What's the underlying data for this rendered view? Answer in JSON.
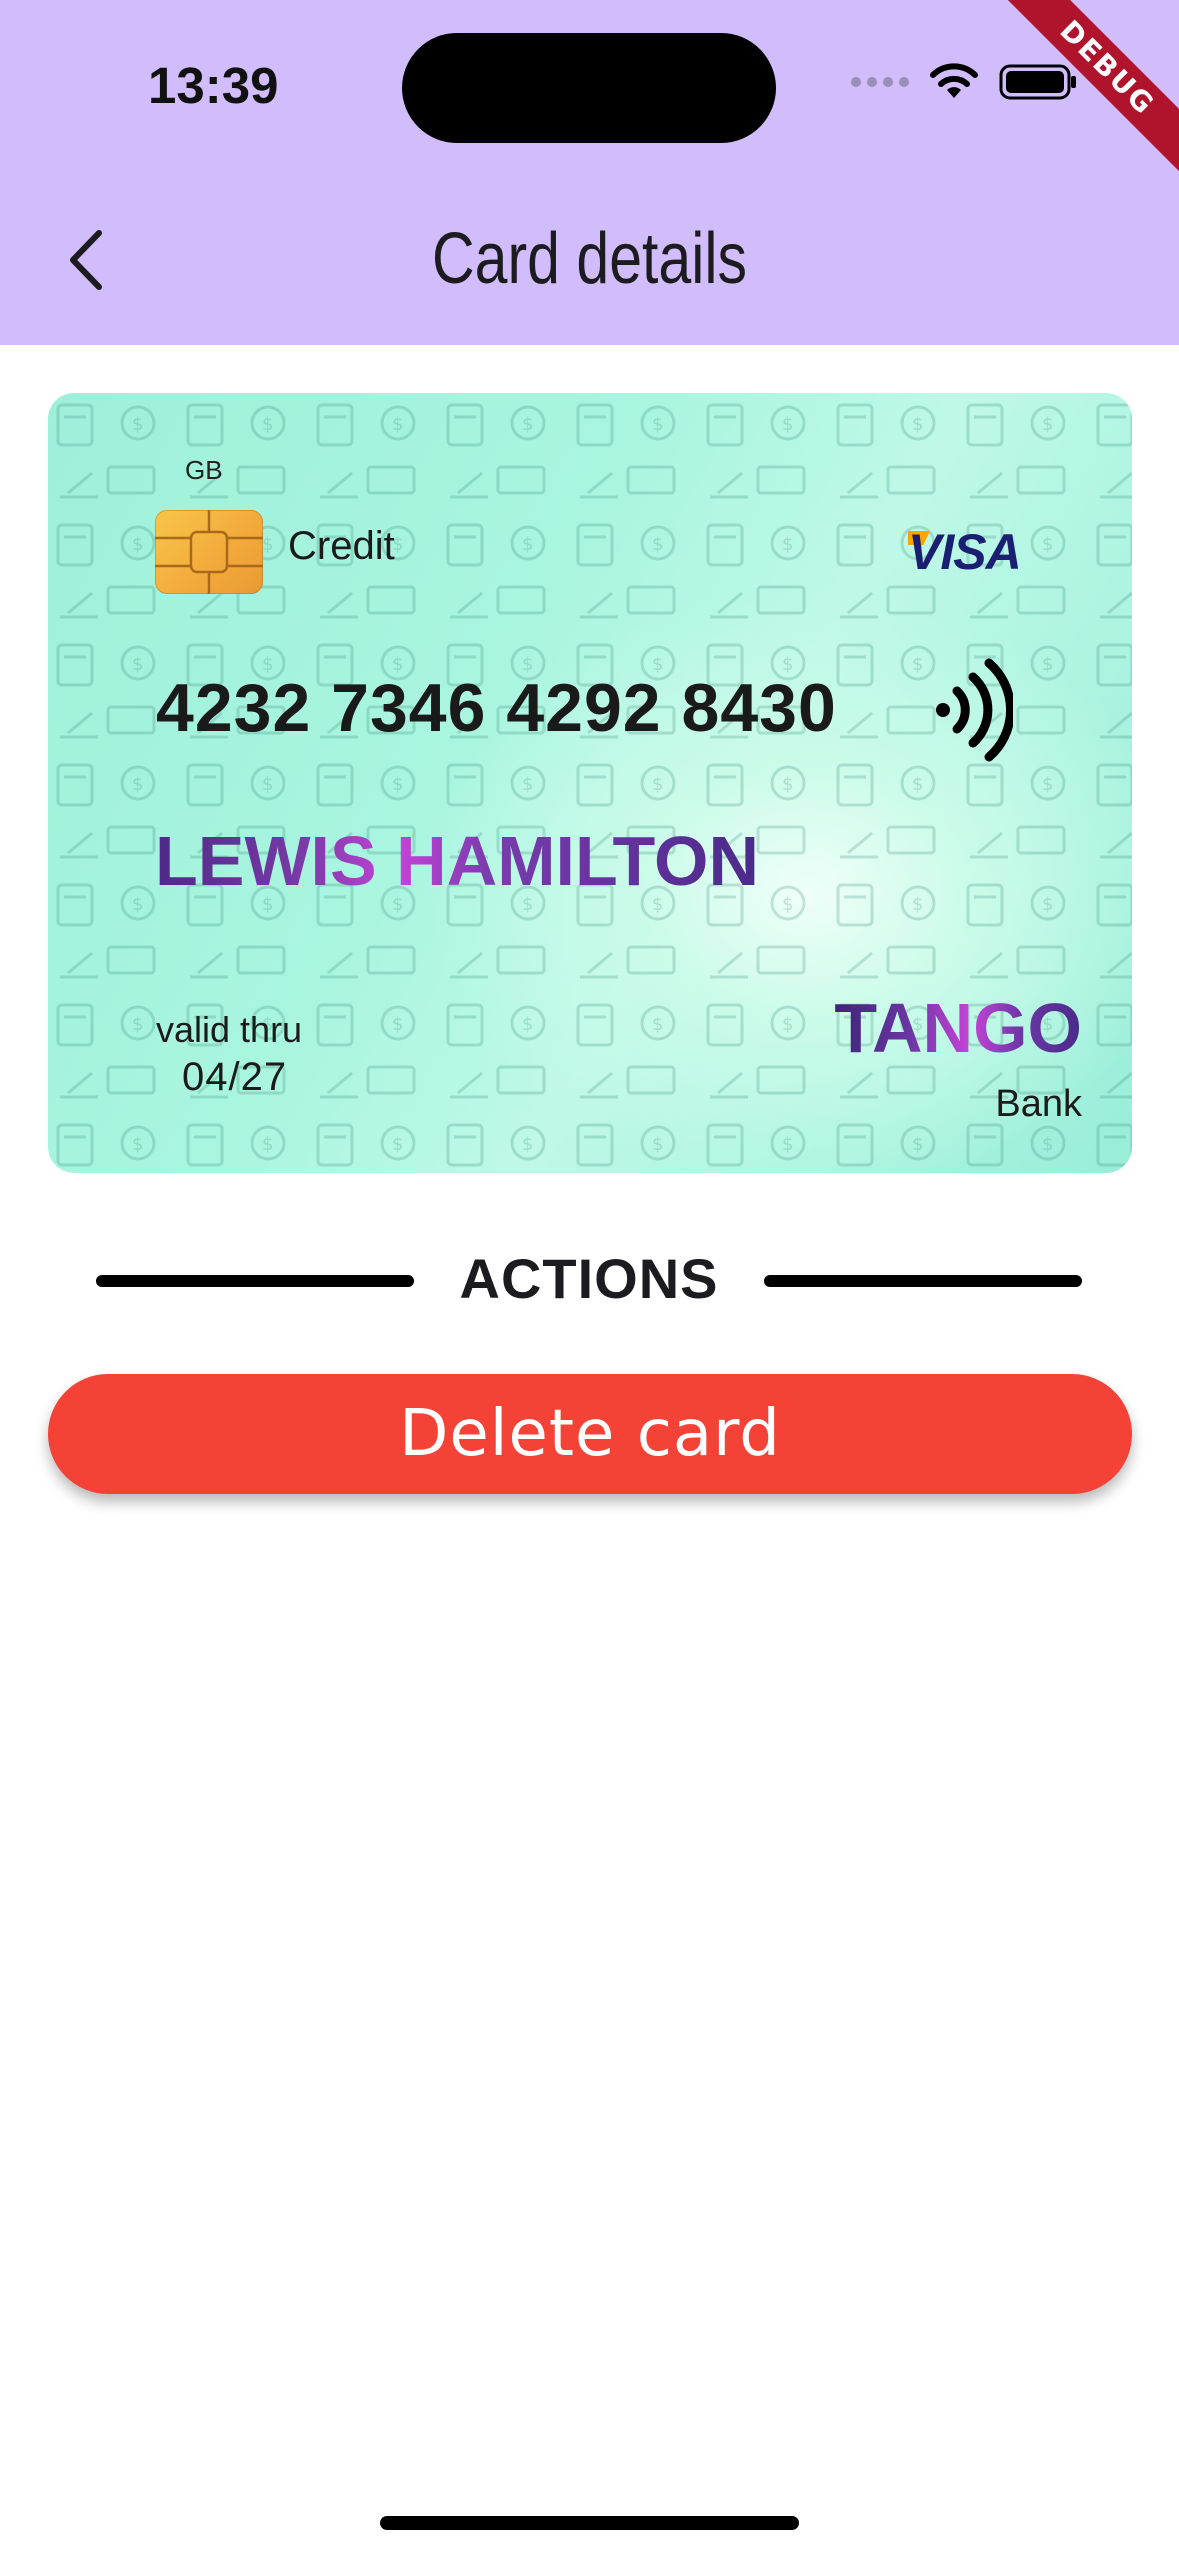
{
  "status_bar": {
    "time": "13:39",
    "debug_banner": "DEBUG"
  },
  "header": {
    "title": "Card details",
    "background": "#d1bcfc"
  },
  "card": {
    "country": "GB",
    "type": "Credit",
    "network": "VISA",
    "number": "4232 7346 4292 8430",
    "holder": "LEWIS HAMILTON",
    "valid_label": "valid thru",
    "valid_date": "04/27",
    "bank_name": "TANGO",
    "bank_sub": "Bank"
  },
  "actions": {
    "section_label": "ACTIONS",
    "delete_label": "Delete card",
    "delete_color": "#f44336"
  }
}
